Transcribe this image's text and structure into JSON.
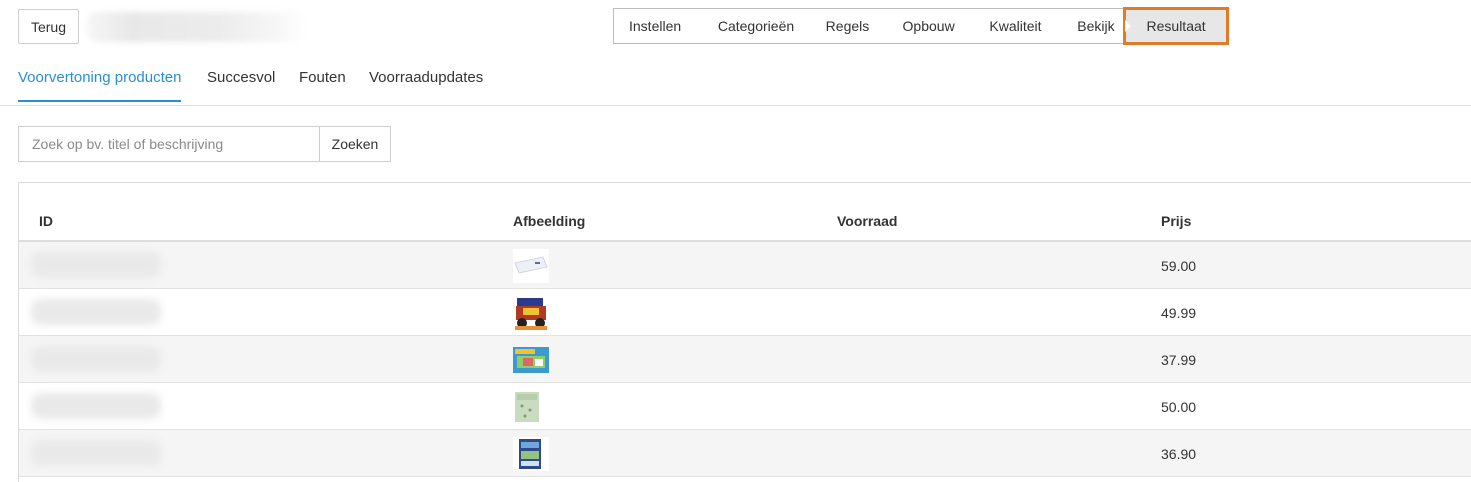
{
  "header": {
    "back_label": "Terug",
    "wizard_steps": [
      "Instellen",
      "Categorieën",
      "Regels",
      "Opbouw",
      "Kwaliteit",
      "Bekijk",
      "Resultaat"
    ],
    "active_step": "Resultaat"
  },
  "tabs": [
    {
      "label": "Voorvertoning producten",
      "active": true
    },
    {
      "label": "Succesvol",
      "active": false
    },
    {
      "label": "Fouten",
      "active": false
    },
    {
      "label": "Voorraadupdates",
      "active": false
    }
  ],
  "search": {
    "placeholder": "Zoek op bv. titel of beschrijving",
    "value": "",
    "button_label": "Zoeken"
  },
  "table": {
    "columns": [
      "ID",
      "Afbeelding",
      "Voorraad",
      "Prijs"
    ],
    "rows": [
      {
        "id": "",
        "image": "product-thumbnail-white-box",
        "stock": "",
        "price": "59.00"
      },
      {
        "id": "",
        "image": "product-thumbnail-toy-car",
        "stock": "",
        "price": "49.99"
      },
      {
        "id": "",
        "image": "product-thumbnail-playset-box",
        "stock": "",
        "price": "37.99"
      },
      {
        "id": "",
        "image": "product-thumbnail-bedding",
        "stock": "",
        "price": "50.00"
      },
      {
        "id": "",
        "image": "product-thumbnail-building-box",
        "stock": "",
        "price": "36.90"
      }
    ]
  },
  "colors": {
    "accent": "#2a8fd0",
    "highlight": "#e07b2a",
    "row_alt": "#f5f5f5"
  }
}
